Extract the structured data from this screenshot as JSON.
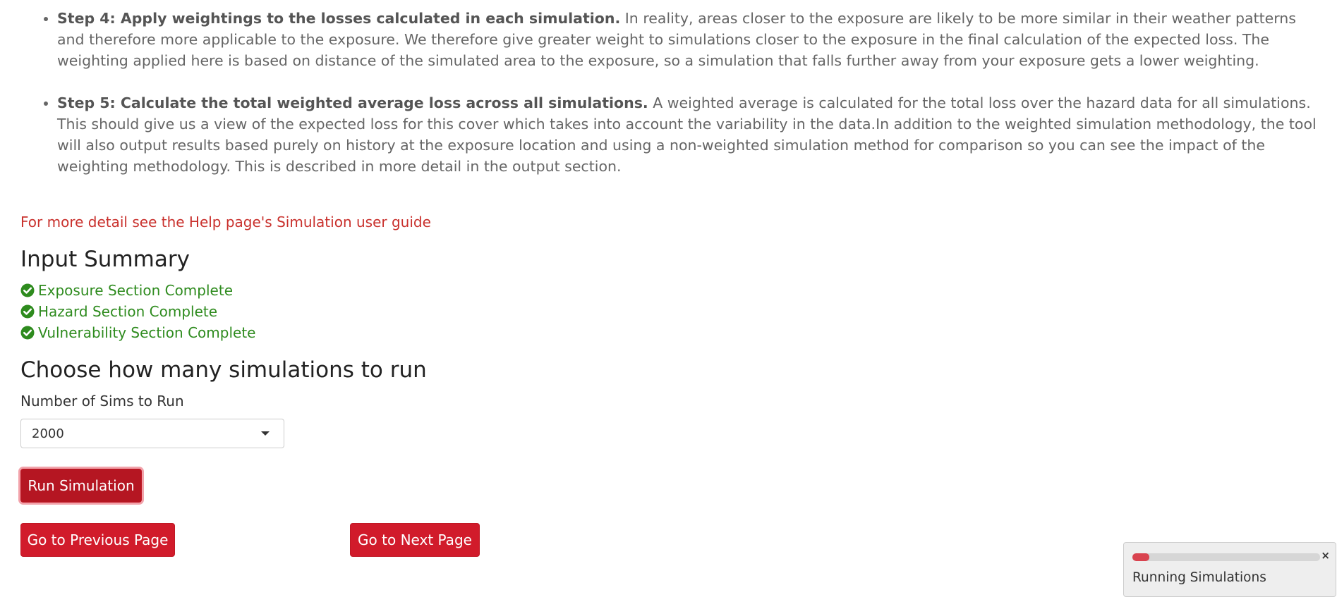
{
  "steps": [
    {
      "bold": "Step 4: Apply weightings to the losses calculated in each simulation.",
      "text": " In reality, areas closer to the exposure are likely to be more similar in their weather patterns and therefore more applicable to the exposure. We therefore give greater weight to simulations closer to the exposure in the final calculation of the expected loss. The weighting applied here is based on distance of the simulated area to the exposure, so a simulation that falls further away from your exposure gets a lower weighting."
    },
    {
      "bold": "Step 5: Calculate the total weighted average loss across all simulations.",
      "text": " A weighted average is calculated for the total loss over the hazard data for all simulations. This should give us a view of the expected loss for this cover which takes into account the variability in the data.In addition to the weighted simulation methodology, the tool will also output results based purely on history at the exposure location and using a non-weighted simulation method for comparison so you can see the impact of the weighting methodology. This is described in more detail in the output section."
    }
  ],
  "help_link": "For more detail see the Help page's Simulation user guide",
  "input_summary": {
    "title": "Input Summary",
    "items": [
      {
        "label": "Exposure Section Complete",
        "icon": "check-circle-icon"
      },
      {
        "label": "Hazard Section Complete",
        "icon": "check-circle-icon"
      },
      {
        "label": "Vulnerability Section Complete",
        "icon": "check-circle-icon"
      }
    ],
    "color": "#2e8b1e"
  },
  "simulations": {
    "title": "Choose how many simulations to run",
    "label": "Number of Sims to Run",
    "selected": "2000",
    "run_button": "Run Simulation"
  },
  "nav": {
    "prev": "Go to Previous Page",
    "next": "Go to Next Page"
  },
  "notification": {
    "text": "Running Simulations",
    "progress": 0.09,
    "close": "×"
  },
  "colors": {
    "accent": "#d11b2b",
    "link": "#c9302c",
    "success": "#2e8b1e",
    "progress": "#d9434f"
  }
}
